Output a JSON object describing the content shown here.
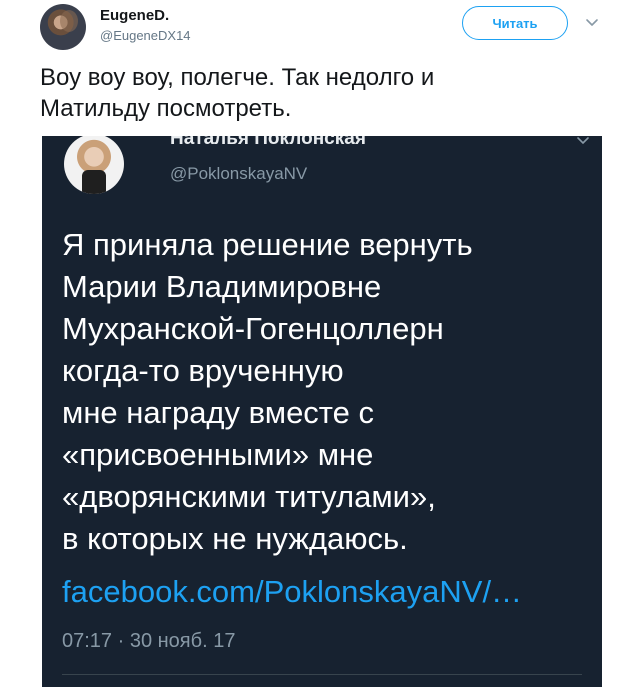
{
  "author": {
    "display_name": "EugeneD.",
    "handle": "@EugeneDX14",
    "avatar_icon": "user-avatar-photo"
  },
  "follow_button": {
    "label": "Читать"
  },
  "caret_icon": "chevron-down-icon",
  "tweet": {
    "text": "Воу воу воу, полегче. Так недолго и\nМатильду посмотреть."
  },
  "embedded": {
    "display_name": "Наталья Поклонская",
    "handle": "@PoklonskayaNV",
    "avatar_icon": "user-avatar-photo",
    "text": "Я приняла решение вернуть\nМарии Владимировне\nМухранской-Гогенцоллерн\nкогда-то врученную\nмне награду вместе с\n«присвоенными» мне\n«дворянскими титулами»,\nв которых не нуждаюсь.",
    "link": "facebook.com/PoklonskayaNV/…",
    "timestamp": "07:17 · 30 нояб. 17",
    "background_color": "#172230",
    "link_color": "#1da1f2"
  },
  "colors": {
    "accent": "#1da1f2",
    "text_primary": "#14171a",
    "text_secondary": "#657786"
  }
}
